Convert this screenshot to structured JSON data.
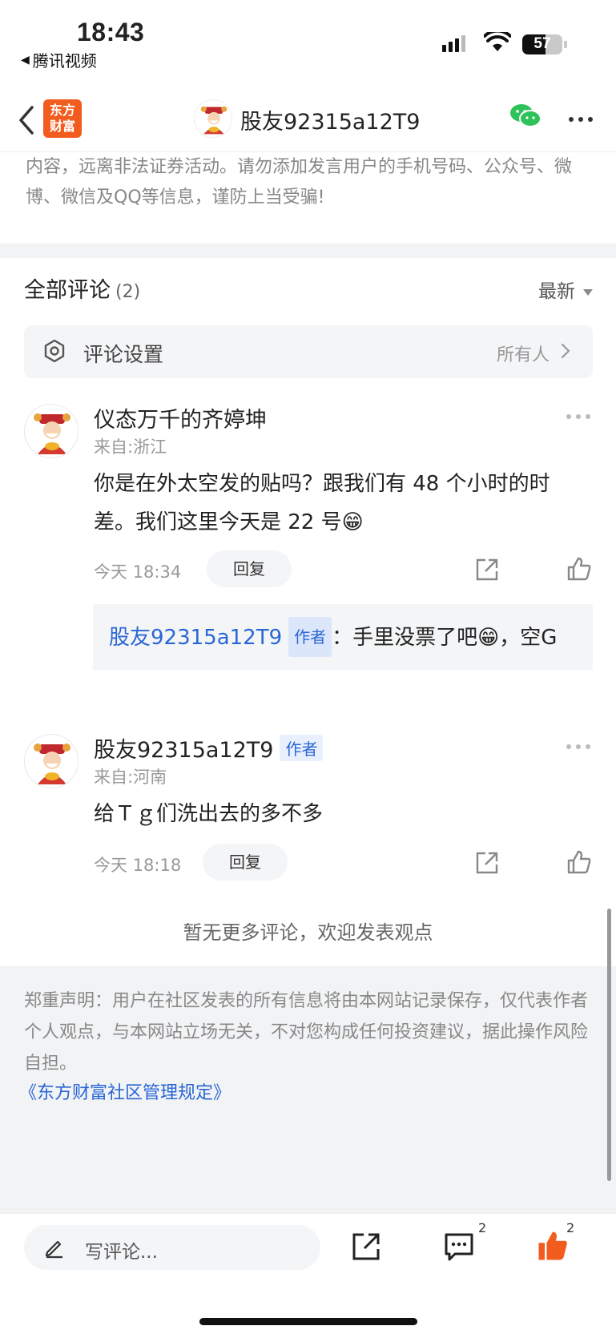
{
  "status_bar": {
    "time": "18:43",
    "back_app": "腾讯视频",
    "battery": "57",
    "battery_level": 0.57
  },
  "nav": {
    "logo_text_line1": "东方",
    "logo_text_line2": "财富",
    "title": "股友92315a12T9"
  },
  "notice": {
    "text": "内容，远离非法证券活动。请勿添加发言用户的手机号码、公众号、微博、微信及QQ等信息，谨防上当受骗!"
  },
  "comments_header": {
    "title": "全部评论",
    "count": "(2)",
    "sort": "最新"
  },
  "settings": {
    "label": "评论设置",
    "value": "所有人"
  },
  "comments": [
    {
      "username": "仪态万千的齐婷坤",
      "location": "来自:浙江",
      "text": "你是在外太空发的贴吗？跟我们有 48 个小时的时差。我们这里今天是 22 号😁",
      "time": "今天 18:34",
      "reply_label": "回复",
      "reply": {
        "name": "股友92315a12T9",
        "badge": "作者",
        "sep": "：",
        "text": "手里没票了吧😁，空G"
      }
    },
    {
      "username": "股友92315a12T9",
      "badge": "作者",
      "location": "来自:河南",
      "text": "给Ｔｇ们洗出去的多不多",
      "time": "今天 18:18",
      "reply_label": "回复"
    }
  ],
  "no_more": "暂无更多评论，欢迎发表观点",
  "disclaimer": {
    "text": "郑重声明：用户在社区发表的所有信息将由本网站记录保存，仅代表作者个人观点，与本网站立场无关，不对您构成任何投资建议，据此操作风险自担。",
    "link": "《东方财富社区管理规定》"
  },
  "bottom_bar": {
    "placeholder": "写评论...",
    "comment_count": "2",
    "like_count": "2",
    "accent": "#f25c1e"
  }
}
